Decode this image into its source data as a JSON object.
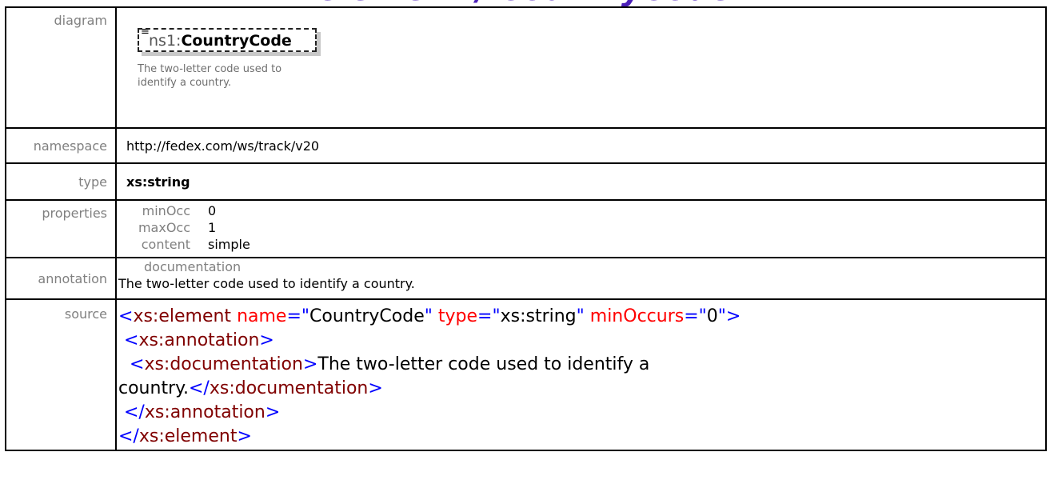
{
  "header": {
    "title": "element / CountryCode"
  },
  "rows": {
    "diagram": {
      "label": "diagram",
      "element_prefix": "ns1:",
      "element_name": "CountryCode",
      "description": "The two-letter code used to identify a country."
    },
    "namespace": {
      "label": "namespace",
      "value": "http://fedex.com/ws/track/v20"
    },
    "type": {
      "label": "type",
      "value": "xs:string"
    },
    "properties": {
      "label": "properties",
      "items": [
        {
          "key": "minOcc",
          "value": "0"
        },
        {
          "key": "maxOcc",
          "value": "1"
        },
        {
          "key": "content",
          "value": "simple"
        }
      ]
    },
    "annotation": {
      "label": "annotation",
      "key": "documentation",
      "value": "The two-letter code used to identify a country."
    },
    "source": {
      "label": "source",
      "l1_open": "<",
      "l1_tag": "xs:element",
      "l1_attr1": "name",
      "l1_eq1": "=\"",
      "l1_val1": "CountryCode",
      "l1_q1": "\"",
      "l1_attr2": "type",
      "l1_eq2": "=\"",
      "l1_val2": "xs:string",
      "l1_q2": "\"",
      "l1_attr3": "minOccurs",
      "l1_eq3": "=\"",
      "l1_val3": "0",
      "l1_close": "\">",
      "l2_open": "<",
      "l2_tag": "xs:annotation",
      "l2_close": ">",
      "l3_open": "<",
      "l3_tag": "xs:documentation",
      "l3_close": ">",
      "l3_text": "The two-letter code used to identify a",
      "l4_text": "country.",
      "l4_open": "</",
      "l4_tag": "xs:documentation",
      "l4_close": ">",
      "l5_open": "</",
      "l5_tag": "xs:annotation",
      "l5_close": ">",
      "l6_open": "</",
      "l6_tag": "xs:element",
      "l6_close": ">"
    }
  }
}
